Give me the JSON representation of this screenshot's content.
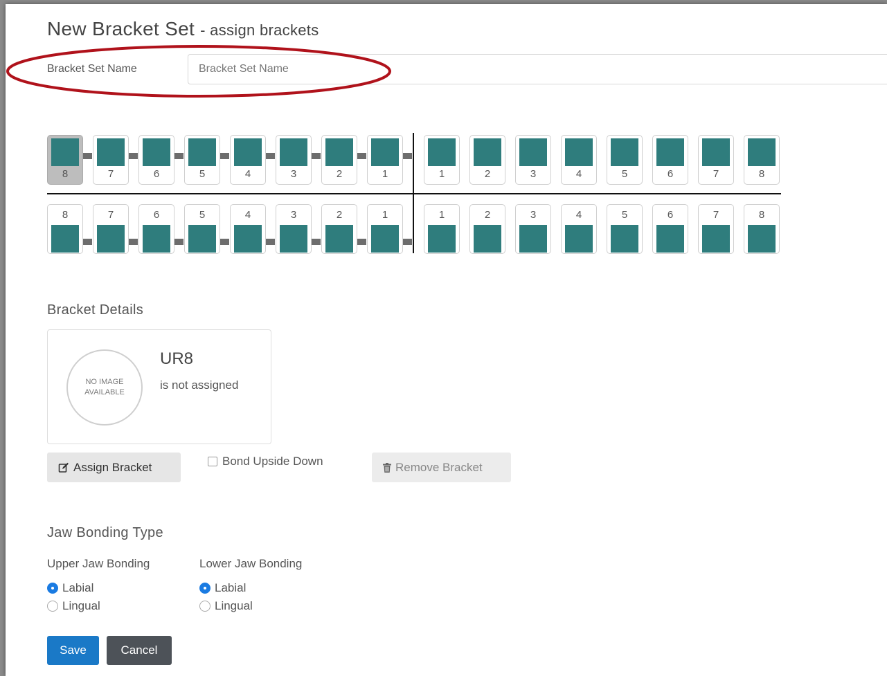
{
  "header": {
    "title": "New Bracket Set",
    "subtitle": "- assign brackets"
  },
  "name_field": {
    "label": "Bracket Set Name",
    "placeholder": "Bracket Set Name",
    "value": ""
  },
  "upper_teeth": [
    "8",
    "7",
    "6",
    "5",
    "4",
    "3",
    "2",
    "1",
    "1",
    "2",
    "3",
    "4",
    "5",
    "6",
    "7",
    "8"
  ],
  "lower_teeth": [
    "8",
    "7",
    "6",
    "5",
    "4",
    "3",
    "2",
    "1",
    "1",
    "2",
    "3",
    "4",
    "5",
    "6",
    "7",
    "8"
  ],
  "selected_tooth": "UR8",
  "bracket_details": {
    "heading": "Bracket Details",
    "image_placeholder_line1": "NO IMAGE",
    "image_placeholder_line2": "AVAILABLE",
    "bracket_id": "UR8",
    "status": "is not assigned"
  },
  "actions": {
    "assign_label": "Assign Bracket",
    "bond_upside_down_label": "Bond Upside Down",
    "bond_upside_down_checked": false,
    "remove_label": "Remove Bracket"
  },
  "jaw_bonding": {
    "heading": "Jaw Bonding Type",
    "upper": {
      "label": "Upper Jaw Bonding",
      "options": [
        "Labial",
        "Lingual"
      ],
      "selected": "Labial"
    },
    "lower": {
      "label": "Lower Jaw Bonding",
      "options": [
        "Labial",
        "Lingual"
      ],
      "selected": "Labial"
    }
  },
  "footer": {
    "save_label": "Save",
    "cancel_label": "Cancel"
  },
  "colors": {
    "bracket": "#2f7d7d",
    "highlight_oval": "#b0121b",
    "primary": "#1a79c7",
    "secondary": "#4d5258"
  }
}
